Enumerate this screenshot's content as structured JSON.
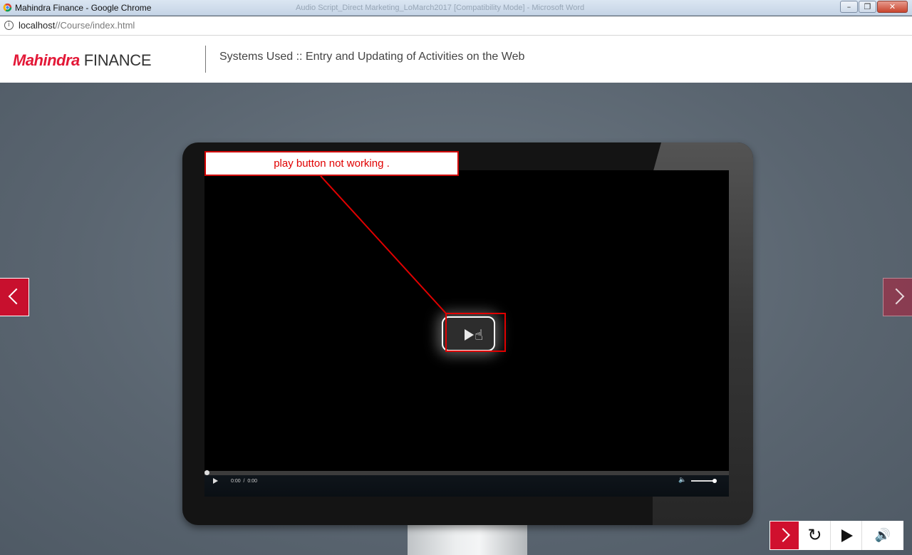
{
  "browser": {
    "window_title": "Mahindra Finance - Google Chrome",
    "background_window_title": "Audio Script_Direct Marketing_LoMarch2017 [Compatibility Mode] - Microsoft Word",
    "url_host": "localhost",
    "url_path": "//Course/index.html",
    "window_buttons": {
      "minimize": "–",
      "maximize": "❐",
      "close": "✕"
    }
  },
  "header": {
    "brand_name": "Mahindra",
    "brand_sub": "FINANCE",
    "course_title": "Systems Used :: Entry and Updating of Activities on the Web"
  },
  "video": {
    "time_current": "0:00",
    "time_separator": "/",
    "time_total": "0:00",
    "volume_level": 0.85
  },
  "annotation": {
    "text": "play button not working ."
  },
  "toolbar": {
    "replay_icon": "↻",
    "audio_icon": "🔊"
  },
  "colors": {
    "brand_red": "#e31837",
    "annotation_red": "#e00000",
    "stage_bg": "#5b6670"
  }
}
